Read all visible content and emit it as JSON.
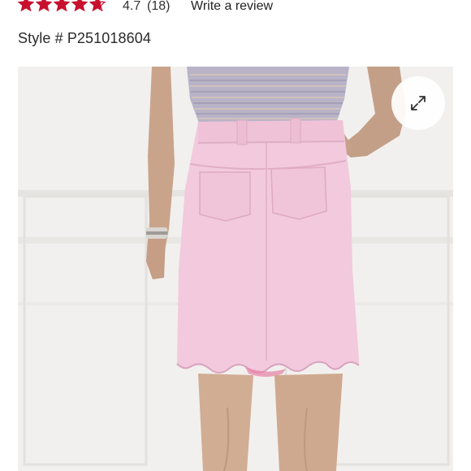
{
  "product": {
    "rating": {
      "value": "4.7",
      "count": "(18)",
      "stars_filled": 4.7,
      "stars_total": 5,
      "star_color": "#c8102e"
    },
    "write_review_label": "Write a review",
    "style_label": "Style # P251018604"
  },
  "image": {
    "expand_icon": "expand-arrows-icon",
    "skirt_color": "#f2c9dd",
    "top_color": "#b9b3c7"
  }
}
